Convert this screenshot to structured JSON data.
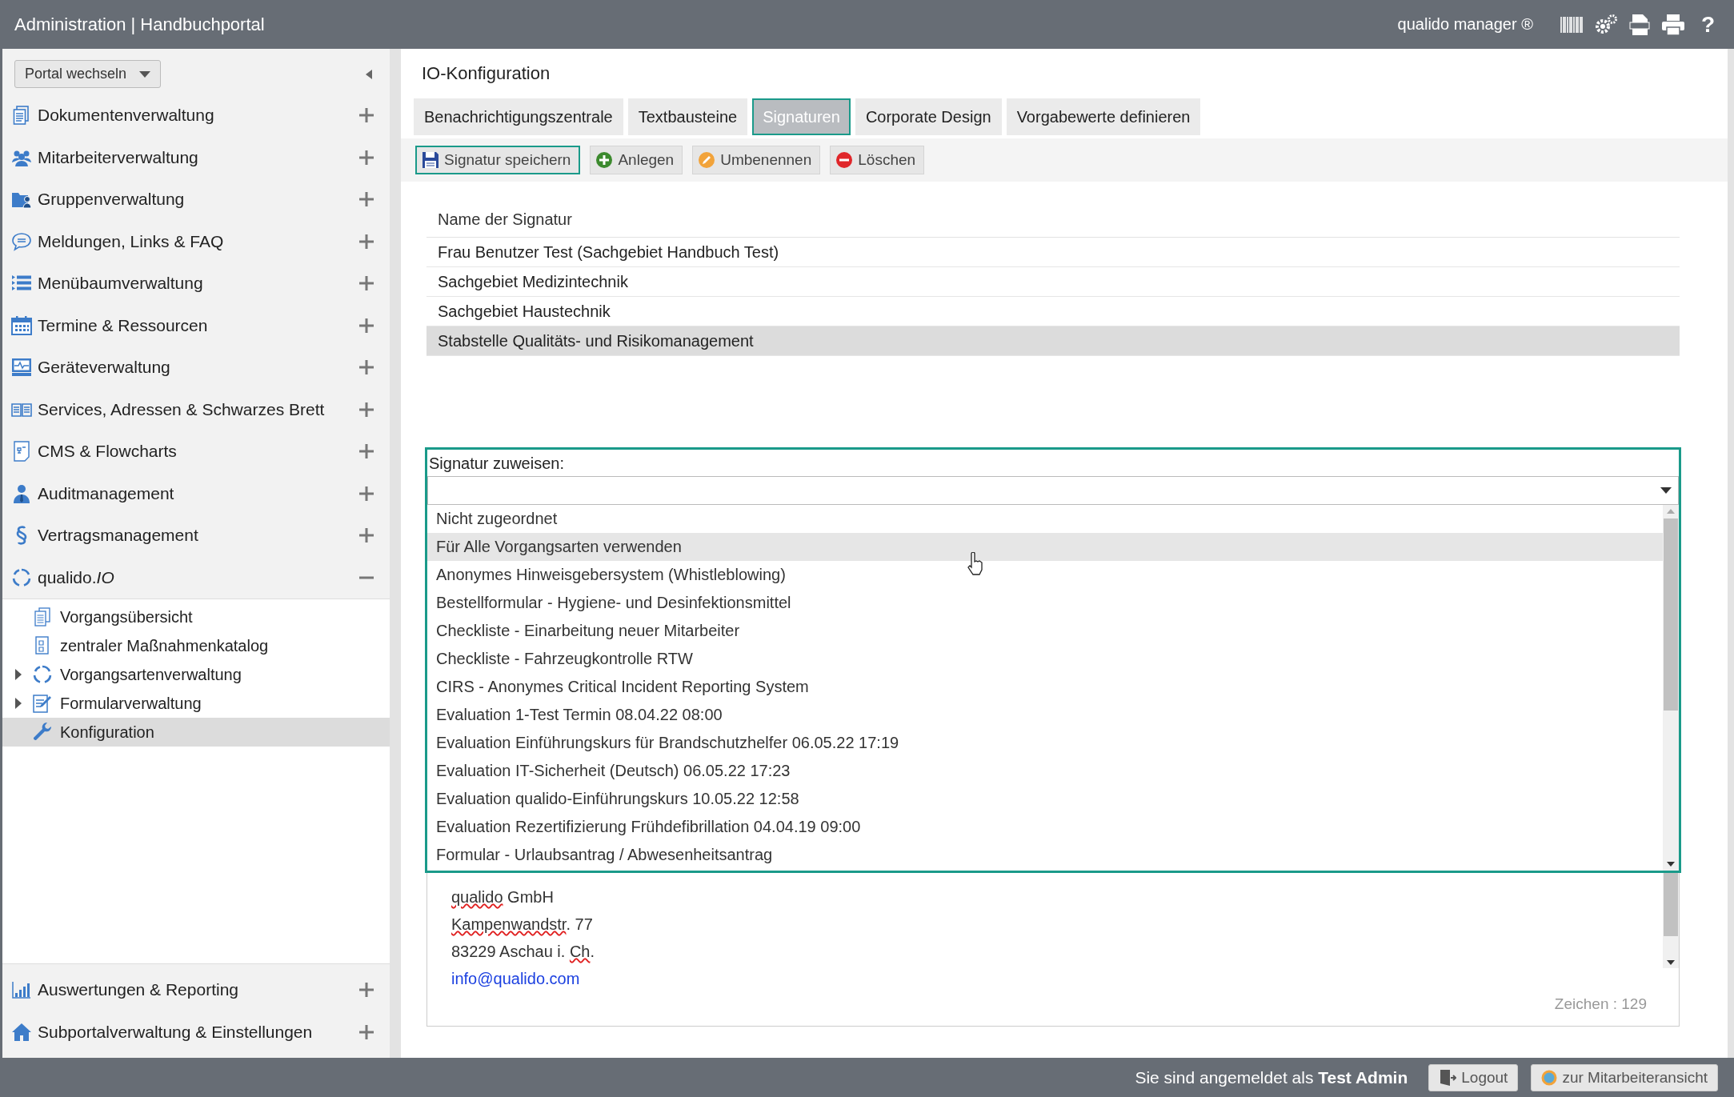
{
  "header": {
    "title": "Administration | Handbuchportal",
    "product": "qualido manager ®",
    "help_label": "?"
  },
  "sidebar": {
    "portal_switch": "Portal wechseln",
    "items": [
      {
        "label": "Dokumentenverwaltung",
        "expanded": false
      },
      {
        "label": "Mitarbeiterverwaltung",
        "expanded": false
      },
      {
        "label": "Gruppenverwaltung",
        "expanded": false
      },
      {
        "label": "Meldungen, Links & FAQ",
        "expanded": false
      },
      {
        "label": "Menübaumverwaltung",
        "expanded": false
      },
      {
        "label": "Termine & Ressourcen",
        "expanded": false
      },
      {
        "label": "Geräteverwaltung",
        "expanded": false
      },
      {
        "label": "Services, Adressen & Schwarzes Brett",
        "expanded": false
      },
      {
        "label": "CMS & Flowcharts",
        "expanded": false
      },
      {
        "label": "Auditmanagement",
        "expanded": false
      },
      {
        "label": "Vertragsmanagement",
        "expanded": false
      },
      {
        "label": "qualido.*IO*",
        "expanded": true,
        "children": [
          {
            "label": "Vorgangsübersicht",
            "expandable": false,
            "selected": false
          },
          {
            "label": "zentraler Maßnahmenkatalog",
            "expandable": false,
            "selected": false
          },
          {
            "label": "Vorgangsartenverwaltung",
            "expandable": true,
            "selected": false
          },
          {
            "label": "Formularverwaltung",
            "expandable": true,
            "selected": false
          },
          {
            "label": "Konfiguration",
            "expandable": false,
            "selected": true
          }
        ]
      }
    ],
    "bottom_items": [
      {
        "label": "Auswertungen & Reporting",
        "expanded": false
      },
      {
        "label": "Subportalverwaltung & Einstellungen",
        "expanded": false
      }
    ]
  },
  "page_title": "IO-Konfiguration",
  "tabs": [
    {
      "label": "Benachrichtigungszentrale",
      "selected": false
    },
    {
      "label": "Textbausteine",
      "selected": false
    },
    {
      "label": "Signaturen",
      "selected": true
    },
    {
      "label": "Corporate Design",
      "selected": false
    },
    {
      "label": "Vorgabewerte definieren",
      "selected": false
    }
  ],
  "toolbar": [
    {
      "label": "Signatur speichern",
      "kind": "save",
      "focused": true
    },
    {
      "label": "Anlegen",
      "kind": "add",
      "focused": false
    },
    {
      "label": "Umbenennen",
      "kind": "rename",
      "focused": false
    },
    {
      "label": "Löschen",
      "kind": "delete",
      "focused": false
    }
  ],
  "table": {
    "column": "Name der Signatur",
    "rows": [
      {
        "name": "Frau Benutzer Test (Sachgebiet Handbuch Test)",
        "selected": false
      },
      {
        "name": "Sachgebiet Medizintechnik",
        "selected": false
      },
      {
        "name": "Sachgebiet Haustechnik",
        "selected": false
      },
      {
        "name": "Stabstelle Qualitäts- und Risikomanagement",
        "selected": true
      }
    ]
  },
  "assign": {
    "label": "Signatur zuweisen:",
    "options": [
      {
        "label": "Nicht zugeordnet",
        "selected": false
      },
      {
        "label": "Für Alle Vorgangsarten verwenden",
        "selected": true
      },
      {
        "label": "Anonymes Hinweisgebersystem (Whistleblowing)",
        "selected": false
      },
      {
        "label": "Bestellformular - Hygiene- und Desinfektionsmittel",
        "selected": false
      },
      {
        "label": "Checkliste - Einarbeitung neuer Mitarbeiter",
        "selected": false
      },
      {
        "label": "Checkliste - Fahrzeugkontrolle RTW",
        "selected": false
      },
      {
        "label": "CIRS - Anonymes Critical Incident Reporting System",
        "selected": false
      },
      {
        "label": "Evaluation 1-Test Termin 08.04.22 08:00",
        "selected": false
      },
      {
        "label": "Evaluation Einführungskurs für Brandschutzhelfer 06.05.22 17:19",
        "selected": false
      },
      {
        "label": "Evaluation IT-Sicherheit (Deutsch) 06.05.22 17:23",
        "selected": false
      },
      {
        "label": "Evaluation qualido-Einführungskurs 10.05.22 12:58",
        "selected": false
      },
      {
        "label": "Evaluation Rezertifizierung Frühdefibrillation 04.04.19 09:00",
        "selected": false
      },
      {
        "label": "Formular - Urlaubsantrag / Abwesenheitsantrag",
        "selected": false
      }
    ]
  },
  "editor": {
    "lines": [
      {
        "kind": "text",
        "segments": [
          {
            "text": "qualido",
            "misspelled": true
          },
          {
            "text": " GmbH",
            "misspelled": false
          }
        ]
      },
      {
        "kind": "text",
        "segments": [
          {
            "text": "Kampenwandstr",
            "misspelled": true
          },
          {
            "text": ". 77",
            "misspelled": false
          }
        ]
      },
      {
        "kind": "text",
        "segments": [
          {
            "text": "83229 Aschau i. ",
            "misspelled": false
          },
          {
            "text": "Ch",
            "misspelled": true
          },
          {
            "text": ".",
            "misspelled": false
          }
        ]
      },
      {
        "kind": "link",
        "segments": [
          {
            "text": "info@qualido.com",
            "misspelled": false
          }
        ]
      }
    ],
    "char_count": "Zeichen : 129"
  },
  "footer": {
    "login_text": "Sie sind angemeldet als **Test Admin**",
    "logout": "Logout",
    "employee_view": "zur Mitarbeiteransicht"
  }
}
